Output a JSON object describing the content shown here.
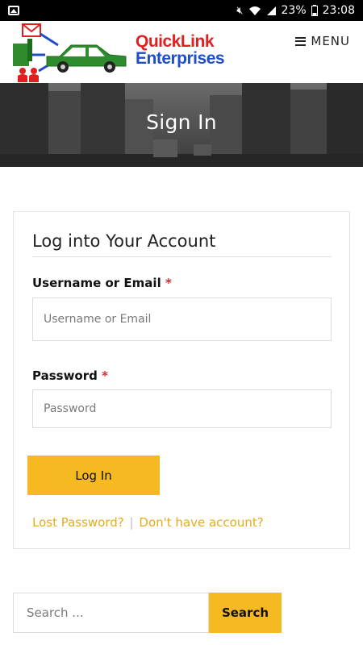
{
  "status_bar": {
    "battery": "23%",
    "time": "23:08",
    "icons": [
      "image-icon",
      "mute-icon",
      "wifi-icon",
      "signal-icon"
    ]
  },
  "header": {
    "logo": {
      "line1": "QuickLink",
      "line2": "Enterprises"
    },
    "menu_label": "MENU"
  },
  "hero": {
    "title": "Sign In"
  },
  "login": {
    "title": "Log into Your Account",
    "username_label": "Username or Email",
    "username_placeholder": "Username or Email",
    "password_label": "Password",
    "password_placeholder": "Password",
    "required_marker": "*",
    "submit_label": "Log In",
    "lost_password": "Lost Password?",
    "separator": "|",
    "register": "Don't have account?"
  },
  "search": {
    "placeholder": "Search ...",
    "button_label": "Search"
  },
  "colors": {
    "accent": "#f5b921",
    "link": "#e5ab1b",
    "required": "#d32f2f",
    "logo_red": "#e02020",
    "logo_blue": "#1f4ec8",
    "logo_green": "#2e8b2e"
  }
}
